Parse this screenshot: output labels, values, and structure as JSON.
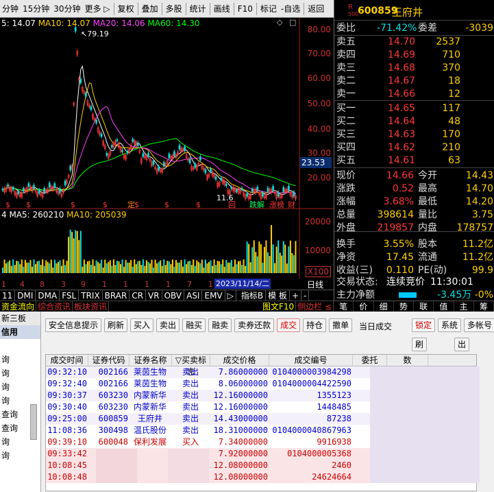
{
  "toolbar": {
    "periods": [
      "分钟",
      "15分钟",
      "30分钟",
      "更多 ▷"
    ],
    "actions": [
      "复权",
      "叠加",
      "多股",
      "统计",
      "画线",
      "F10",
      "标记",
      "-自选",
      "返回"
    ]
  },
  "chart": {
    "ma_line": {
      "prefix": "5: 14.07",
      "ma10": "MA10: 14.07",
      "ma20": "MA20: 14.06",
      "ma60": "MA60: 14.30"
    },
    "price_axis": [
      "80.00",
      "70.00",
      "60.00",
      "50.00",
      "40.00",
      "30.00",
      "20.00"
    ],
    "current_price": "23.53",
    "peak_label": "79.19",
    "low_label": "11.6",
    "vol_line": {
      "prefix": "4",
      "ma5": "MA5: 260210",
      "ma10": "MA10: 205039"
    },
    "vol_axis": [
      "20000",
      "10000",
      "X100"
    ],
    "date_ticks": [
      "1",
      "4",
      "8",
      "3",
      "9",
      "1",
      "1",
      "1",
      "1",
      "7",
      "1",
      "5",
      "1",
      "2",
      "8"
    ],
    "date_highlight": "2023/11/14/二",
    "rilian": "日线",
    "markers": {
      "s": "$",
      "ding": "定",
      "hui": "回",
      "dieji": "跌解",
      "zhangbang": "涨榜",
      "cai": "财"
    }
  },
  "indicator_bar": [
    "11",
    "DMI",
    "DMA",
    "FSL",
    "TRIX",
    "BRAR",
    "CR",
    "VR",
    "OBV",
    "ASI",
    "EMV",
    "▷",
    "指标B",
    "模 板",
    "+",
    "-"
  ],
  "bottom_tabs": [
    "资金流向",
    "综合资讯",
    "板块资讯",
    "图文F10",
    "侧边栏 ≤"
  ],
  "stock": {
    "code": "600859",
    "name": "王府井",
    "r_badge": "R",
    "r_sub": "500"
  },
  "quote": {
    "weibi_label": "委比",
    "weibi": "-71.42%",
    "weicha_label": "委差",
    "weicha": "-3039",
    "sells": [
      {
        "label": "卖五",
        "price": "14.70",
        "vol": "2537"
      },
      {
        "label": "卖四",
        "price": "14.69",
        "vol": "710"
      },
      {
        "label": "卖三",
        "price": "14.68",
        "vol": "370"
      },
      {
        "label": "卖二",
        "price": "14.67",
        "vol": "18"
      },
      {
        "label": "卖一",
        "price": "14.66",
        "vol": "12"
      }
    ],
    "buys": [
      {
        "label": "买一",
        "price": "14.65",
        "vol": "117"
      },
      {
        "label": "买二",
        "price": "14.64",
        "vol": "48"
      },
      {
        "label": "买三",
        "price": "14.63",
        "vol": "170"
      },
      {
        "label": "买四",
        "price": "14.62",
        "vol": "210"
      },
      {
        "label": "买五",
        "price": "14.61",
        "vol": "63"
      }
    ],
    "stats": [
      {
        "l1": "现价",
        "v1": "14.66",
        "c1": "red",
        "l2": "今开",
        "v2": "14.43",
        "c2": "red"
      },
      {
        "l1": "涨跌",
        "v1": "0.52",
        "c1": "red",
        "l2": "最高",
        "v2": "14.70",
        "c2": "red"
      },
      {
        "l1": "涨幅",
        "v1": "3.68%",
        "c1": "red",
        "l2": "最低",
        "v2": "14.20",
        "c2": "red"
      },
      {
        "l1": "总量",
        "v1": "398614",
        "c1": "yel",
        "l2": "量比",
        "v2": "3.75",
        "c2": "red"
      },
      {
        "l1": "外盘",
        "v1": "219857",
        "c1": "red",
        "l2": "内盘",
        "v2": "178757",
        "c2": "cyan"
      },
      {
        "l1": "换手",
        "v1": "3.55%",
        "c1": "yel",
        "l2": "股本",
        "v2": "11.2亿",
        "c2": "yel"
      },
      {
        "l1": "净资",
        "v1": "17.45",
        "c1": "yel",
        "l2": "流通",
        "v2": "11.2亿",
        "c2": "yel"
      },
      {
        "l1": "收益(三)",
        "v1": "0.110",
        "c1": "yel",
        "l2": "PE(动)",
        "v2": "99.9",
        "c2": "yel"
      }
    ],
    "status_label": "交易状态:",
    "status": "连续竞价",
    "status_time": "11:30:01",
    "zhuli_label": "主力净额",
    "zhuli": "-3.45万",
    "zhuli_pct": "-0%",
    "side_tabs": [
      "笔",
      "价",
      "细",
      "势",
      "联",
      "值",
      "主",
      "筹"
    ]
  },
  "lower": {
    "left_nav": [
      "新三板",
      "信用",
      "",
      "询",
      "询",
      "询",
      "询",
      "查询",
      "查询",
      "询",
      "询"
    ],
    "buttons": [
      "安全信息提示",
      "刷新",
      "买入",
      "卖出",
      "融买",
      "融卖",
      "卖券还款",
      "成交",
      "持仓",
      "撤单"
    ],
    "today_label": "当日成交",
    "right_buttons": [
      "锁定",
      "系统",
      "多帐号"
    ],
    "sub_buttons": [
      "刷",
      "出"
    ],
    "columns": [
      "成交时间",
      "证券代码",
      "证券名称",
      "▽买卖标志",
      "成交价格",
      "成交编号",
      "委托",
      "数"
    ],
    "rows": [
      {
        "time": "09:32:10",
        "code": "002166",
        "name": "莱茵生物",
        "side": "卖出",
        "price": "7.86000000",
        "no": "0104000003984298",
        "color": "blue"
      },
      {
        "time": "09:32:40",
        "code": "002166",
        "name": "莱茵生物",
        "side": "卖出",
        "price": "8.06000000",
        "no": "0104000004422590",
        "color": "blue"
      },
      {
        "time": "09:30:37",
        "code": "603230",
        "name": "内蒙新华",
        "side": "卖出",
        "price": "12.16000000",
        "no": "1355123",
        "color": "blue"
      },
      {
        "time": "09:30:40",
        "code": "603230",
        "name": "内蒙新华",
        "side": "卖出",
        "price": "12.16000000",
        "no": "1448485",
        "color": "blue"
      },
      {
        "time": "09:25:00",
        "code": "600859",
        "name": "王府井",
        "side": "卖出",
        "price": "14.43000000",
        "no": "87238",
        "color": "blue"
      },
      {
        "time": "11:08:36",
        "code": "300498",
        "name": "温氏股份",
        "side": "卖出",
        "price": "18.31000000",
        "no": "0104000040867963",
        "color": "blue"
      },
      {
        "time": "09:39:10",
        "code": "600048",
        "name": "保利发展",
        "side": "买入",
        "price": "7.34000000",
        "no": "9916938",
        "color": "red"
      },
      {
        "time": "09:33:42",
        "code": "",
        "name": "",
        "side": "",
        "price": "7.92000000",
        "no": "0104000005368",
        "color": "red"
      },
      {
        "time": "10:08:45",
        "code": "",
        "name": "",
        "side": "",
        "price": "12.08000000",
        "no": "2460",
        "color": "red"
      },
      {
        "time": "10:08:48",
        "code": "603",
        "name": "",
        "side": "买入",
        "price": "12.08000000",
        "no": "24624664",
        "color": "red"
      }
    ]
  },
  "colors": {
    "up": "#ff3838",
    "down": "#00e060",
    "ma5": "#ffffff",
    "ma10": "#ffd000",
    "ma20": "#ff40ff",
    "ma60": "#00ff00"
  }
}
